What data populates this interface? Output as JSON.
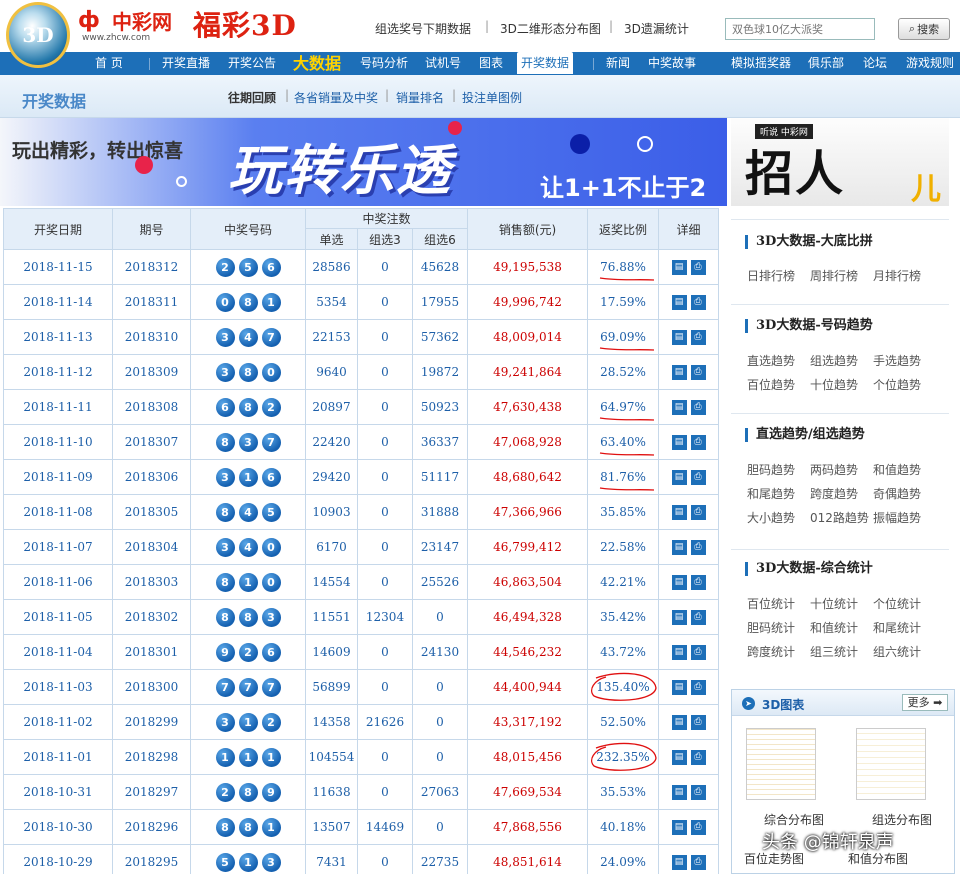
{
  "header": {
    "logo_ball_text": "3D",
    "brand_name": "中彩网",
    "brand_url": "www.zhcw.com",
    "brand_product": "福彩3D",
    "top_links": [
      "组选奖号下期数据",
      "3D二维形态分布图",
      "3D遗漏统计"
    ],
    "search_placeholder": "双色球10亿大派奖",
    "search_button": "搜索"
  },
  "nav": {
    "items": [
      "首 页",
      "开奖直播",
      "开奖公告",
      "大数据",
      "号码分析",
      "试机号",
      "图表",
      "开奖数据",
      "新闻",
      "中奖故事",
      "模拟摇奖器",
      "俱乐部",
      "论坛",
      "游戏规则"
    ],
    "active": "开奖数据"
  },
  "subnav": {
    "title": "开奖数据",
    "links": [
      "往期回顾",
      "各省销量及中奖",
      "销量排名",
      "投注单图例"
    ]
  },
  "banner": {
    "left_text": "玩出精彩，转出惊喜",
    "title": "玩转乐透",
    "sub": "让1+1不止于2",
    "side_small": "听说 中彩网",
    "side_big": "招人",
    "side_suffix": "儿"
  },
  "table": {
    "headers": {
      "date": "开奖日期",
      "issue": "期号",
      "numbers": "中奖号码",
      "bets_group": "中奖注数",
      "single": "单选",
      "group3": "组选3",
      "group6": "组选6",
      "sales": "销售额(元)",
      "ratio": "返奖比例",
      "detail": "详细"
    },
    "rows": [
      {
        "date": "2018-11-15",
        "issue": "2018312",
        "nums": [
          "2",
          "5",
          "6"
        ],
        "single": "28586",
        "g3": "0",
        "g6": "45628",
        "sales": "49,195,538",
        "ratio": "76.88%",
        "hl": true
      },
      {
        "date": "2018-11-14",
        "issue": "2018311",
        "nums": [
          "0",
          "8",
          "1"
        ],
        "single": "5354",
        "g3": "0",
        "g6": "17955",
        "sales": "49,996,742",
        "ratio": "17.59%",
        "hl": false
      },
      {
        "date": "2018-11-13",
        "issue": "2018310",
        "nums": [
          "3",
          "4",
          "7"
        ],
        "single": "22153",
        "g3": "0",
        "g6": "57362",
        "sales": "48,009,014",
        "ratio": "69.09%",
        "hl": true
      },
      {
        "date": "2018-11-12",
        "issue": "2018309",
        "nums": [
          "3",
          "8",
          "0"
        ],
        "single": "9640",
        "g3": "0",
        "g6": "19872",
        "sales": "49,241,864",
        "ratio": "28.52%",
        "hl": false
      },
      {
        "date": "2018-11-11",
        "issue": "2018308",
        "nums": [
          "6",
          "8",
          "2"
        ],
        "single": "20897",
        "g3": "0",
        "g6": "50923",
        "sales": "47,630,438",
        "ratio": "64.97%",
        "hl": true
      },
      {
        "date": "2018-11-10",
        "issue": "2018307",
        "nums": [
          "8",
          "3",
          "7"
        ],
        "single": "22420",
        "g3": "0",
        "g6": "36337",
        "sales": "47,068,928",
        "ratio": "63.40%",
        "hl": true
      },
      {
        "date": "2018-11-09",
        "issue": "2018306",
        "nums": [
          "3",
          "1",
          "6"
        ],
        "single": "29420",
        "g3": "0",
        "g6": "51117",
        "sales": "48,680,642",
        "ratio": "81.76%",
        "hl": true
      },
      {
        "date": "2018-11-08",
        "issue": "2018305",
        "nums": [
          "8",
          "4",
          "5"
        ],
        "single": "10903",
        "g3": "0",
        "g6": "31888",
        "sales": "47,366,966",
        "ratio": "35.85%",
        "hl": false
      },
      {
        "date": "2018-11-07",
        "issue": "2018304",
        "nums": [
          "3",
          "4",
          "0"
        ],
        "single": "6170",
        "g3": "0",
        "g6": "23147",
        "sales": "46,799,412",
        "ratio": "22.58%",
        "hl": false
      },
      {
        "date": "2018-11-06",
        "issue": "2018303",
        "nums": [
          "8",
          "1",
          "0"
        ],
        "single": "14554",
        "g3": "0",
        "g6": "25526",
        "sales": "46,863,504",
        "ratio": "42.21%",
        "hl": false
      },
      {
        "date": "2018-11-05",
        "issue": "2018302",
        "nums": [
          "8",
          "8",
          "3"
        ],
        "single": "11551",
        "g3": "12304",
        "g6": "0",
        "sales": "46,494,328",
        "ratio": "35.42%",
        "hl": false
      },
      {
        "date": "2018-11-04",
        "issue": "2018301",
        "nums": [
          "9",
          "2",
          "6"
        ],
        "single": "14609",
        "g3": "0",
        "g6": "24130",
        "sales": "44,546,232",
        "ratio": "43.72%",
        "hl": false
      },
      {
        "date": "2018-11-03",
        "issue": "2018300",
        "nums": [
          "7",
          "7",
          "7"
        ],
        "single": "56899",
        "g3": "0",
        "g6": "0",
        "sales": "44,400,944",
        "ratio": "135.40%",
        "hl": true
      },
      {
        "date": "2018-11-02",
        "issue": "2018299",
        "nums": [
          "3",
          "1",
          "2"
        ],
        "single": "14358",
        "g3": "21626",
        "g6": "0",
        "sales": "43,317,192",
        "ratio": "52.50%",
        "hl": false
      },
      {
        "date": "2018-11-01",
        "issue": "2018298",
        "nums": [
          "1",
          "1",
          "1"
        ],
        "single": "104554",
        "g3": "0",
        "g6": "0",
        "sales": "48,015,456",
        "ratio": "232.35%",
        "hl": true
      },
      {
        "date": "2018-10-31",
        "issue": "2018297",
        "nums": [
          "2",
          "8",
          "9"
        ],
        "single": "11638",
        "g3": "0",
        "g6": "27063",
        "sales": "47,669,534",
        "ratio": "35.53%",
        "hl": false
      },
      {
        "date": "2018-10-30",
        "issue": "2018296",
        "nums": [
          "8",
          "8",
          "1"
        ],
        "single": "13507",
        "g3": "14469",
        "g6": "0",
        "sales": "47,868,556",
        "ratio": "40.18%",
        "hl": false
      },
      {
        "date": "2018-10-29",
        "issue": "2018295",
        "nums": [
          "5",
          "1",
          "3"
        ],
        "single": "7431",
        "g3": "0",
        "g6": "22735",
        "sales": "48,851,614",
        "ratio": "24.09%",
        "hl": false
      }
    ],
    "detail_icons": [
      "doc-icon",
      "print-icon"
    ]
  },
  "sidebar": {
    "blocks": [
      {
        "title": "3D大数据-大底比拼",
        "links": [
          "日排行榜",
          "周排行榜",
          "月排行榜"
        ]
      },
      {
        "title": "3D大数据-号码趋势",
        "links": [
          "直选趋势",
          "组选趋势",
          "手选趋势",
          "百位趋势",
          "十位趋势",
          "个位趋势"
        ]
      },
      {
        "title": "直选趋势/组选趋势",
        "links": [
          "胆码趋势",
          "两码趋势",
          "和值趋势",
          "和尾趋势",
          "跨度趋势",
          "奇偶趋势",
          "大小趋势",
          "012路趋势",
          "振幅趋势"
        ]
      },
      {
        "title": "3D大数据-综合统计",
        "links": [
          "百位统计",
          "十位统计",
          "个位统计",
          "胆码统计",
          "和值统计",
          "和尾统计",
          "跨度统计",
          "组三统计",
          "组六统计"
        ]
      }
    ],
    "chart_box": {
      "title": "3D图表",
      "more": "更多",
      "thumb_labels": [
        "综合分布图",
        "组选分布图",
        "百位走势图",
        "和值分布图"
      ]
    }
  },
  "watermark": "头条 @锦轩泉声"
}
